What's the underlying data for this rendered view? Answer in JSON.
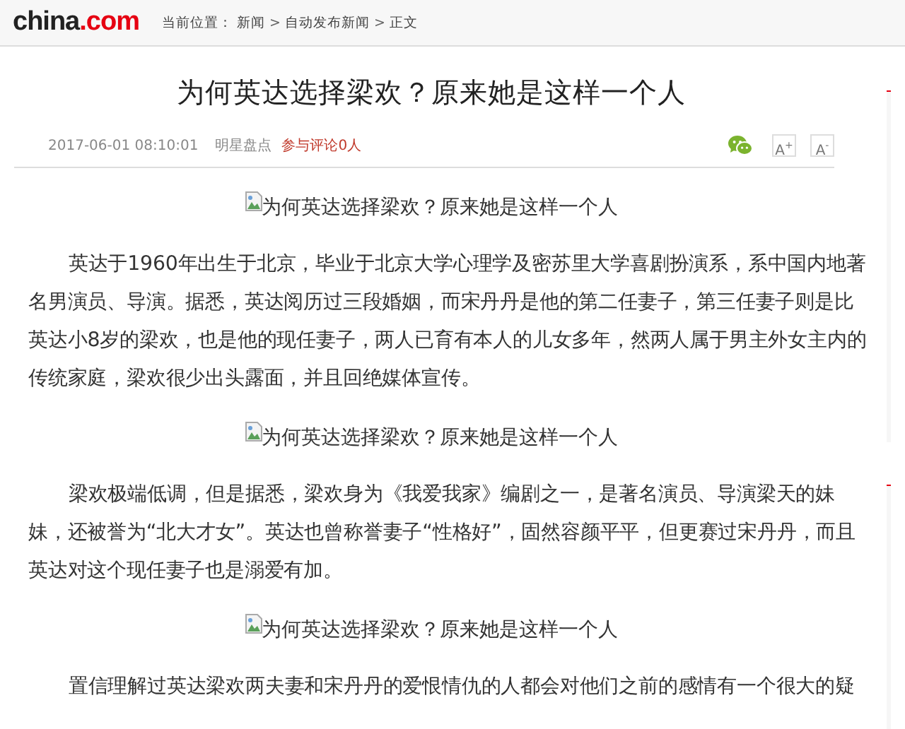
{
  "header": {
    "logo": {
      "main": "china",
      "accent": ".com"
    },
    "breadcrumb_label": "当前位置：",
    "breadcrumb": [
      {
        "label": "新闻"
      },
      {
        "label": "自动发布新闻"
      },
      {
        "label": "正文"
      }
    ],
    "separator": ">"
  },
  "article": {
    "title": "为何英达选择梁欢？原来她是这样一个人",
    "meta": {
      "date": "2017-06-01 08:10:01",
      "source": "明星盘点",
      "comments": "参与评论0人"
    },
    "font_buttons": [
      "A$^{+}$",
      "A$^{-}$"
    ],
    "blocks": [
      {
        "kind": "image",
        "alt": "为何英达选择梁欢？原来她是这样一个人"
      },
      {
        "kind": "paragraph",
        "text": "英达于1960年出生于北京，毕业于北京大学心理学及密苏里大学喜剧扮演系，系中国内地著名男演员、导演。据悉，英达阅历过三段婚姻，而宋丹丹是他的第二任妻子，第三任妻子则是比英达小8岁的梁欢，也是他的现任妻子，两人已育有本人的儿女多年，然两人属于男主外女主内的传统家庭，梁欢很少出头露面，并且回绝媒体宣传。"
      },
      {
        "kind": "image",
        "alt": "为何英达选择梁欢？原来她是这样一个人"
      },
      {
        "kind": "paragraph",
        "text": "梁欢极端低调，但是据悉，梁欢身为《我爱我家》编剧之一，是著名演员、导演梁天的妹妹，还被誉为“北大才女”。英达也曾称誉妻子“性格好”，固然容颜平平，但更赛过宋丹丹，而且英达对这个现任妻子也是溺爱有加。"
      },
      {
        "kind": "image",
        "alt": "为何英达选择梁欢？原来她是这样一个人"
      },
      {
        "kind": "paragraph",
        "text": "置信理解过英达梁欢两夫妻和宋丹丹的爱恨情仇的人都会对他们之前的感情有一个很大的疑"
      }
    ]
  }
}
